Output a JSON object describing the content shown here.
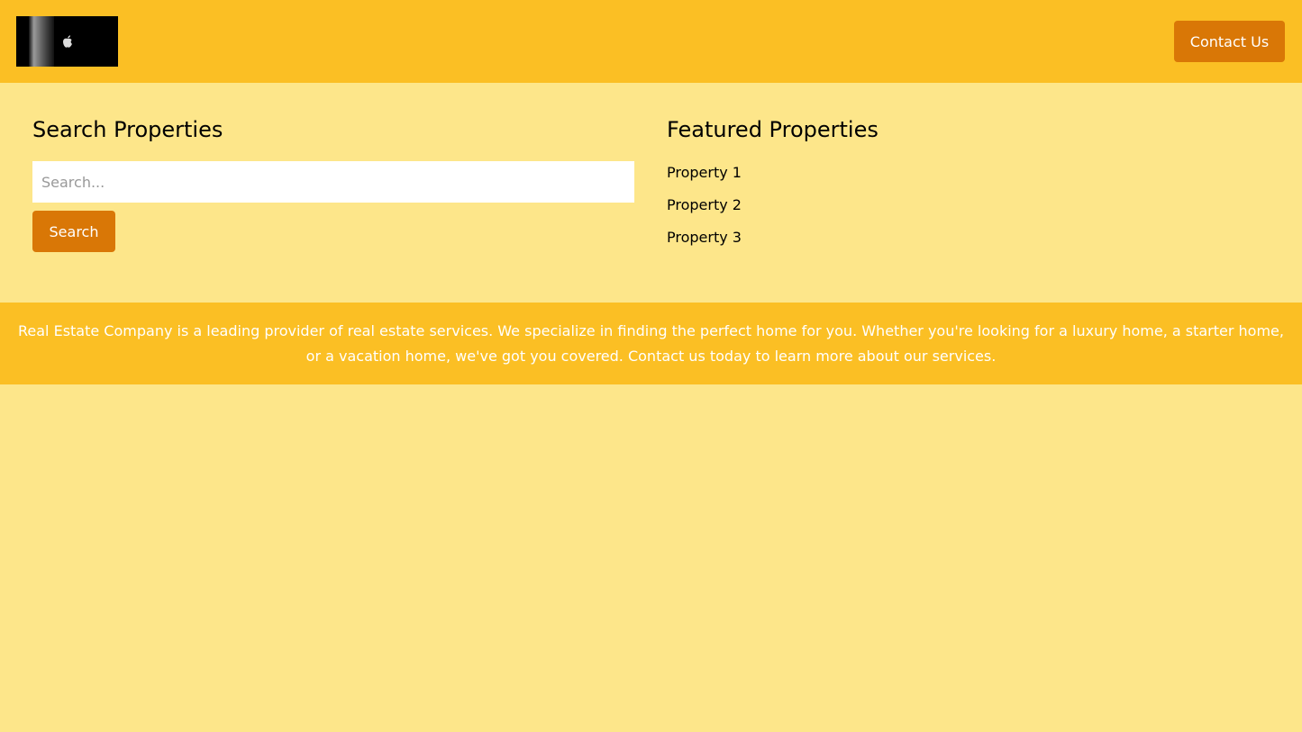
{
  "header": {
    "logo_icon": "apple-logo-icon",
    "contact_label": "Contact Us"
  },
  "search": {
    "title": "Search Properties",
    "placeholder": "Search...",
    "button_label": "Search"
  },
  "featured": {
    "title": "Featured Properties",
    "items": [
      "Property 1",
      "Property 2",
      "Property 3"
    ]
  },
  "footer": {
    "text": "Real Estate Company is a leading provider of real estate services. We specialize in finding the perfect home for you. Whether you're looking for a luxury home, a starter home, or a vacation home, we've got you covered. Contact us today to learn more about our services."
  },
  "colors": {
    "header_bg": "#fbbf24",
    "page_bg": "#fde68a",
    "accent": "#d97706"
  }
}
